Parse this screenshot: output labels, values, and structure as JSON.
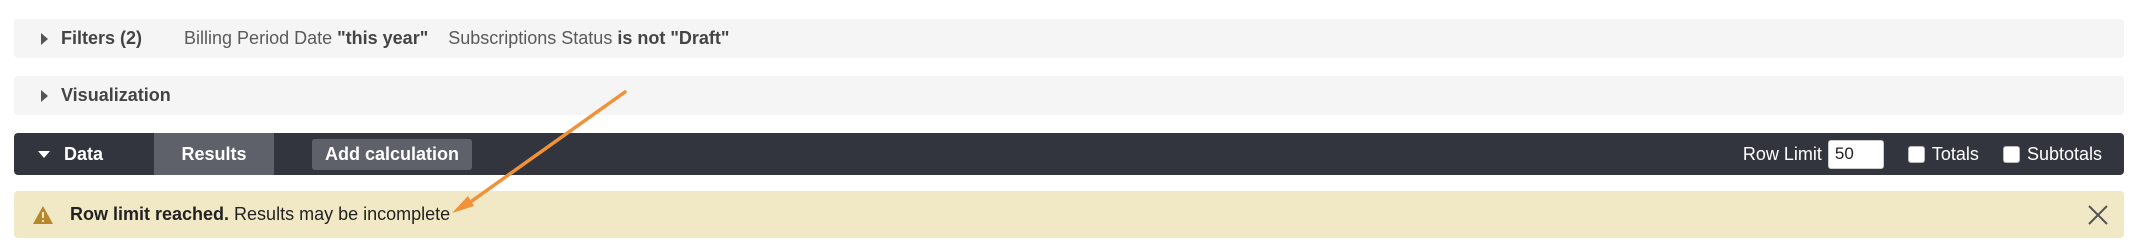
{
  "filters": {
    "title": "Filters (2)",
    "items": [
      {
        "label": "Billing Period Date ",
        "value": "\"this year\""
      },
      {
        "label": "Subscriptions Status ",
        "value": "is not \"Draft\""
      }
    ]
  },
  "visualization": {
    "title": "Visualization"
  },
  "data_bar": {
    "data_tab": "Data",
    "results_tab": "Results",
    "add_calculation": "Add calculation",
    "row_limit_label": "Row Limit",
    "row_limit_value": "50",
    "totals_label": "Totals",
    "subtotals_label": "Subtotals"
  },
  "warning": {
    "bold": "Row limit reached.",
    "text": " Results may be incomplete"
  },
  "colors": {
    "dark_bar": "#32353e",
    "tab_active": "#5e6169",
    "warning_bg": "#f1e8c5",
    "warning_icon": "#b8862b",
    "arrow": "#f0923a"
  },
  "icons": {
    "filters_caret": "caret-right-icon",
    "viz_caret": "caret-right-icon",
    "data_caret": "caret-down-icon",
    "warning": "warning-triangle-icon",
    "close": "close-icon"
  }
}
